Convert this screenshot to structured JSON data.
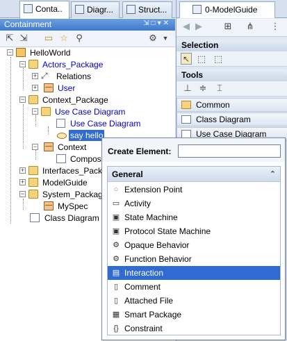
{
  "left_tabs": [
    "Conta..",
    "Diagr...",
    "Struct..."
  ],
  "containment": {
    "title": "Containment"
  },
  "tree": {
    "root": "HelloWorld",
    "actors_package": "Actors_Package",
    "relations": "Relations",
    "user": "User",
    "context_package": "Context_Package",
    "use_case_diagram_pkg": "Use Case Diagram",
    "use_case_diagram": "Use Case Diagram",
    "say_hello": "say hello",
    "context": "Context",
    "compos": "Compos",
    "interfaces_pack": "Interfaces_Pack",
    "model_guide": "ModelGuide",
    "system_package": "System_Packag",
    "my_spec": "MySpec",
    "class_diagram": "Class Diagram"
  },
  "right": {
    "tab": "0-ModelGuide",
    "selection": "Selection",
    "tools": "Tools",
    "common": "Common",
    "class_diagram": "Class Diagram",
    "use_case_diagram": "Use Case Diagram"
  },
  "popup": {
    "title": "Create Element:",
    "input_value": "",
    "group": "General",
    "items": [
      {
        "label": "Extension Point",
        "icon": "extension-point-icon"
      },
      {
        "label": "Activity",
        "icon": "activity-icon"
      },
      {
        "label": "State Machine",
        "icon": "state-machine-icon"
      },
      {
        "label": "Protocol State Machine",
        "icon": "protocol-state-machine-icon"
      },
      {
        "label": "Opaque Behavior",
        "icon": "opaque-behavior-icon"
      },
      {
        "label": "Function Behavior",
        "icon": "function-behavior-icon"
      },
      {
        "label": "Interaction",
        "icon": "interaction-icon"
      },
      {
        "label": "Comment",
        "icon": "comment-icon"
      },
      {
        "label": "Attached File",
        "icon": "attached-file-icon"
      },
      {
        "label": "Smart Package",
        "icon": "smart-package-icon"
      },
      {
        "label": "Constraint",
        "icon": "constraint-icon"
      }
    ],
    "highlighted": "Interaction"
  },
  "colors": {
    "selection_blue": "#2f6bd1",
    "link_blue": "#0000d0",
    "header_blue": "#3d7acc"
  }
}
